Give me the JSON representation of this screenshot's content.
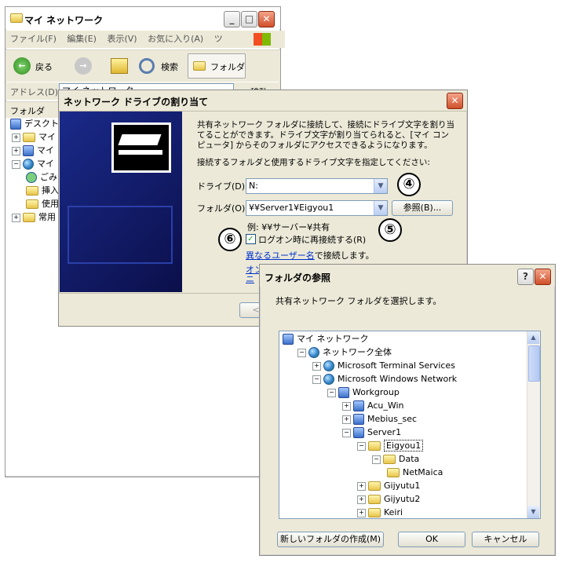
{
  "explorer": {
    "title": "マイ ネットワーク",
    "menu": [
      "ファイル(F)",
      "編集(E)",
      "表示(V)",
      "お気に入り(A)",
      "ツ"
    ],
    "back_label": "戻る",
    "search_label": "検索",
    "folders_label": "フォルダ",
    "address_label": "アドレス(D)",
    "address_value": "マイ ネットワーク",
    "go_label": "移動",
    "folder_pane_label": "フォルダ",
    "tree": [
      "デスクトップ",
      "マイ",
      "マイ",
      "マイ",
      "ごみ",
      "挿入",
      "使用",
      "常用"
    ]
  },
  "map_drive": {
    "title": "ネットワーク ドライブの割り当て",
    "description": "共有ネットワーク フォルダに接続して、接続にドライブ文字を割り当てることができます。ドライブ文字が割り当てられると、[マイ コンピュータ] からそのフォルダにアクセスできるようになります。",
    "instruction": "接続するフォルダと使用するドライブ文字を指定してください:",
    "drive_label": "ドライブ(D):",
    "drive_value": "N:",
    "folder_label": "フォルダ(O):",
    "folder_value": "¥¥Server1¥Eigyou1",
    "browse_label": "参照(B)...",
    "example": "例: ¥¥サーバー¥共有",
    "reconnect_label": "ログオン時に再接続する(R)",
    "reconnect_checked": true,
    "other_user_link": "異なるユーザー名",
    "other_user_suffix": "で接続します。",
    "partial_link_1": "オン",
    "partial_link_2": "ニ",
    "back_button_partial": "<"
  },
  "browse": {
    "title": "フォルダの参照",
    "instruction": "共有ネットワーク フォルダを選択します。",
    "tree": [
      {
        "label": "マイ ネットワーク",
        "icon": "network-icon",
        "expander": ""
      },
      {
        "label": "ネットワーク全体",
        "icon": "globe-icon",
        "expander": "−"
      },
      {
        "label": "Microsoft Terminal Services",
        "icon": "globe-icon",
        "expander": "+"
      },
      {
        "label": "Microsoft Windows Network",
        "icon": "globe-icon",
        "expander": "−"
      },
      {
        "label": "Workgroup",
        "icon": "workgroup-icon",
        "expander": "−"
      },
      {
        "label": "Acu_Win",
        "icon": "computer-icon",
        "expander": "+"
      },
      {
        "label": "Mebius_sec",
        "icon": "computer-icon",
        "expander": "+"
      },
      {
        "label": "Server1",
        "icon": "computer-icon",
        "expander": "−"
      },
      {
        "label": "Eigyou1",
        "icon": "folder-icon",
        "expander": "−"
      },
      {
        "label": "Data",
        "icon": "folder-icon",
        "expander": "−"
      },
      {
        "label": "NetMaica",
        "icon": "folder-icon",
        "expander": ""
      },
      {
        "label": "Gijyutu1",
        "icon": "folder-icon",
        "expander": "+"
      },
      {
        "label": "Gijyutu2",
        "icon": "folder-icon",
        "expander": "+"
      },
      {
        "label": "Keiri",
        "icon": "folder-icon",
        "expander": "+"
      }
    ],
    "selected_item": "Eigyou1",
    "new_folder_label": "新しいフォルダの作成(M)",
    "ok_label": "OK",
    "cancel_label": "キャンセル"
  },
  "callouts": {
    "four": "④",
    "five": "⑤",
    "six": "⑥"
  }
}
